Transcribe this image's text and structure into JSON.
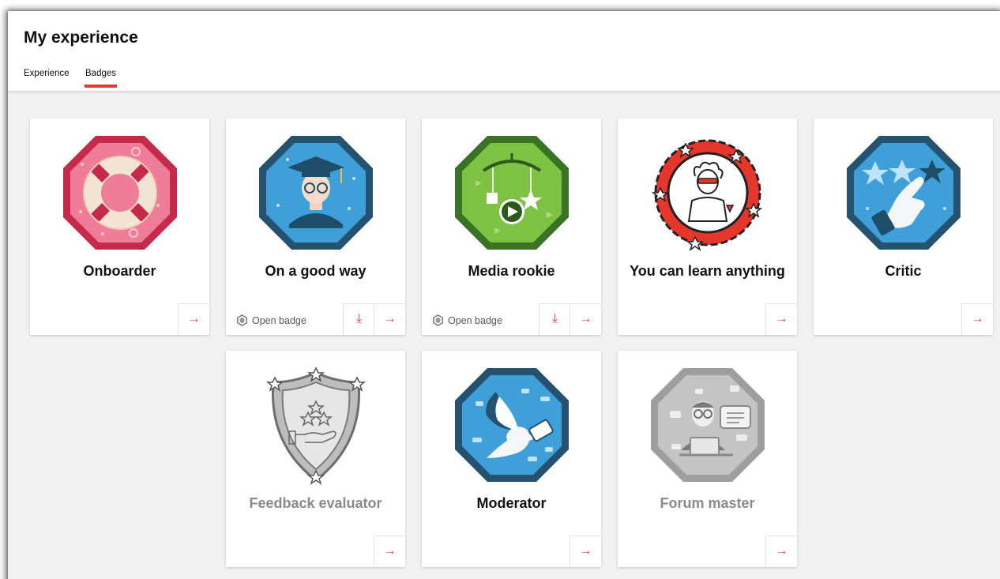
{
  "page": {
    "title": "My experience"
  },
  "tabs": [
    {
      "label": "Experience",
      "active": false
    },
    {
      "label": "Badges",
      "active": true
    }
  ],
  "accent_color": "#e53935",
  "badges": [
    {
      "title": "Onboarder",
      "icon": "lifebuoy-badge-icon",
      "open_badge": false,
      "earned": true
    },
    {
      "title": "On a good way",
      "icon": "graduate-badge-icon",
      "open_badge": true,
      "open_badge_label": "Open badge",
      "earned": true
    },
    {
      "title": "Media rookie",
      "icon": "media-mobile-badge-icon",
      "open_badge": true,
      "open_badge_label": "Open badge",
      "earned": true
    },
    {
      "title": "You can learn anything",
      "icon": "scientist-badge-icon",
      "open_badge": false,
      "earned": true
    },
    {
      "title": "Critic",
      "icon": "thumb-stars-badge-icon",
      "open_badge": false,
      "earned": true
    },
    {
      "title": "Feedback evaluator",
      "icon": "shield-stars-hand-badge-icon",
      "open_badge": false,
      "earned": false
    },
    {
      "title": "Moderator",
      "icon": "dove-badge-icon",
      "open_badge": false,
      "earned": true
    },
    {
      "title": "Forum master",
      "icon": "forum-laptop-badge-icon",
      "open_badge": false,
      "earned": false
    }
  ],
  "buttons": {
    "arrow_glyph": "→",
    "download_glyph": "⤓"
  }
}
